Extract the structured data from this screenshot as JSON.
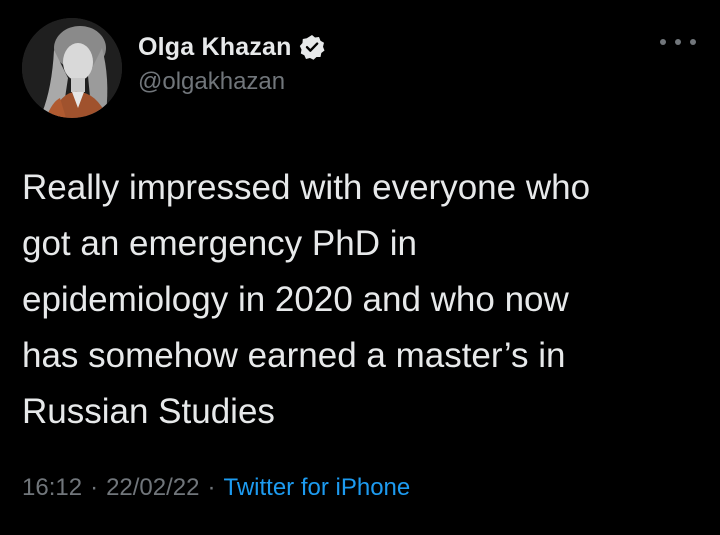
{
  "author": {
    "display_name": "Olga Khazan",
    "handle": "@olgakhazan",
    "verified": true,
    "avatar_icon": "profile-photo"
  },
  "menu": {
    "icon": "more-options-icon"
  },
  "tweet": {
    "text": "Really impressed with everyone who\ngot an emergency PhD in\nepidemiology in 2020 and who now\nhas somehow earned a master’s in\nRussian Studies"
  },
  "meta": {
    "time": "16:12",
    "separator": "·",
    "date": "22/02/22",
    "source": "Twitter for iPhone"
  },
  "colors": {
    "background": "#000000",
    "text": "#e7e9ea",
    "secondary": "#71767b",
    "accent": "#1d9bf0"
  }
}
